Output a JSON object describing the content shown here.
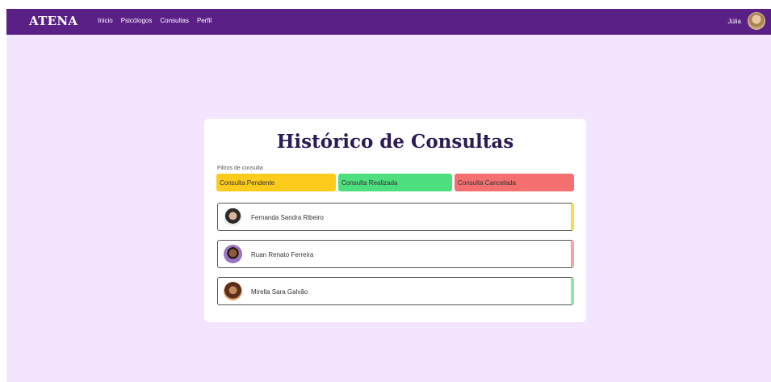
{
  "navbar": {
    "brand": "ATENA",
    "links": [
      "Inicio",
      "Psicólogos",
      "Consultas",
      "Perfil"
    ],
    "user_name": "Júlia"
  },
  "main": {
    "title": "Histórico de Consultas",
    "filters_label": "Filtros de consulta",
    "filters": {
      "pending": "Consulta Pendente",
      "done": "Consulta Realizada",
      "cancelled": "Consulta Cancelada"
    },
    "consultations": [
      {
        "name": "Fernanda Sandra Ribeiro",
        "status": "pending"
      },
      {
        "name": "Ruan Renato Ferreira",
        "status": "cancelled"
      },
      {
        "name": "Mirella Sara Galvão",
        "status": "done"
      }
    ]
  },
  "colors": {
    "navbar": "#5b2086",
    "background": "#f3e5fd",
    "pending": "#fccb1c",
    "done": "#4dde7e",
    "cancelled": "#f46f6f"
  }
}
